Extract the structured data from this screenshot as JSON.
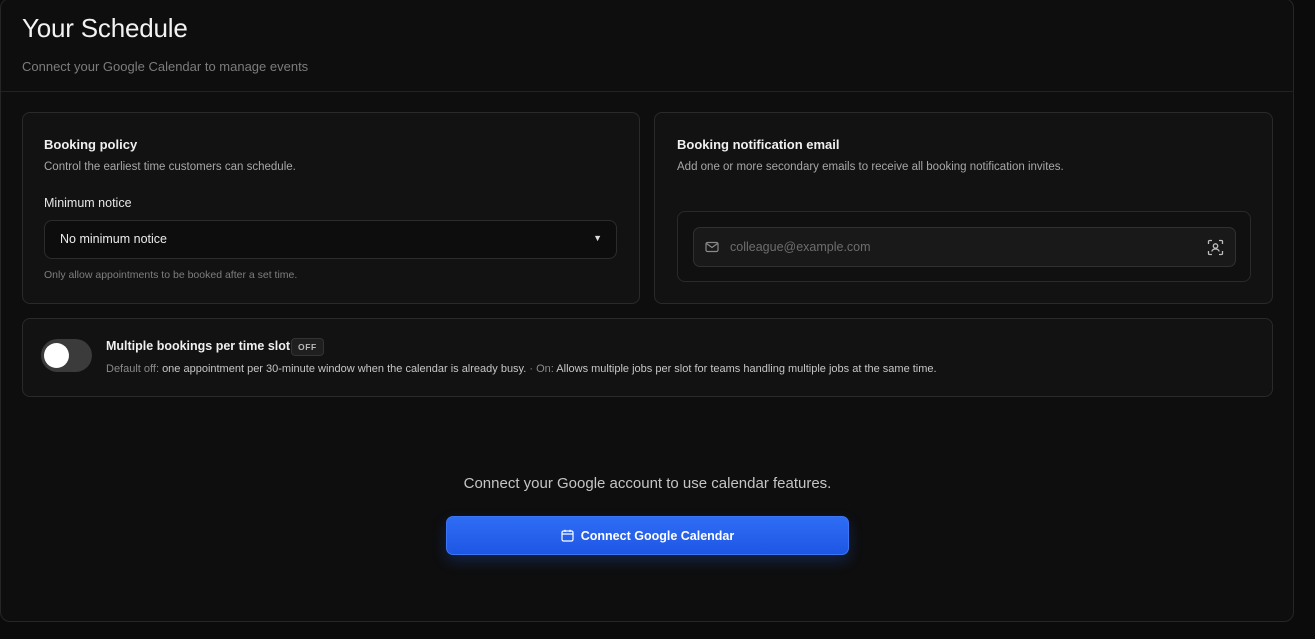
{
  "header": {
    "title": "Your Schedule",
    "subtitle": "Connect your Google Calendar to manage events"
  },
  "booking_policy": {
    "title": "Booking policy",
    "description": "Control the earliest time customers can schedule.",
    "field_label": "Minimum notice",
    "selected_value": "No minimum notice",
    "hint": "Only allow appointments to be booked after a set time."
  },
  "notification_email": {
    "title": "Booking notification email",
    "description": "Add one or more secondary emails to receive all booking notification invites.",
    "input_placeholder": "colleague@example.com",
    "input_value": ""
  },
  "multiple_bookings": {
    "title": "Multiple bookings per time slot",
    "badge": "OFF",
    "enabled": false,
    "default_label": "Default off:",
    "default_text": "one appointment per 30-minute window when the calendar is already busy.",
    "separator": "·",
    "on_label": "On:",
    "on_text": "Allows multiple jobs per slot for teams handling multiple jobs at the same time."
  },
  "connect": {
    "prompt": "Connect your Google account to use calendar features.",
    "button_label": "Connect Google Calendar",
    "button_color": "#2563eb"
  },
  "icons": {
    "caret": "caret-down-icon",
    "mail": "mail-icon",
    "scan": "scan-contact-icon",
    "calendar": "calendar-icon"
  }
}
